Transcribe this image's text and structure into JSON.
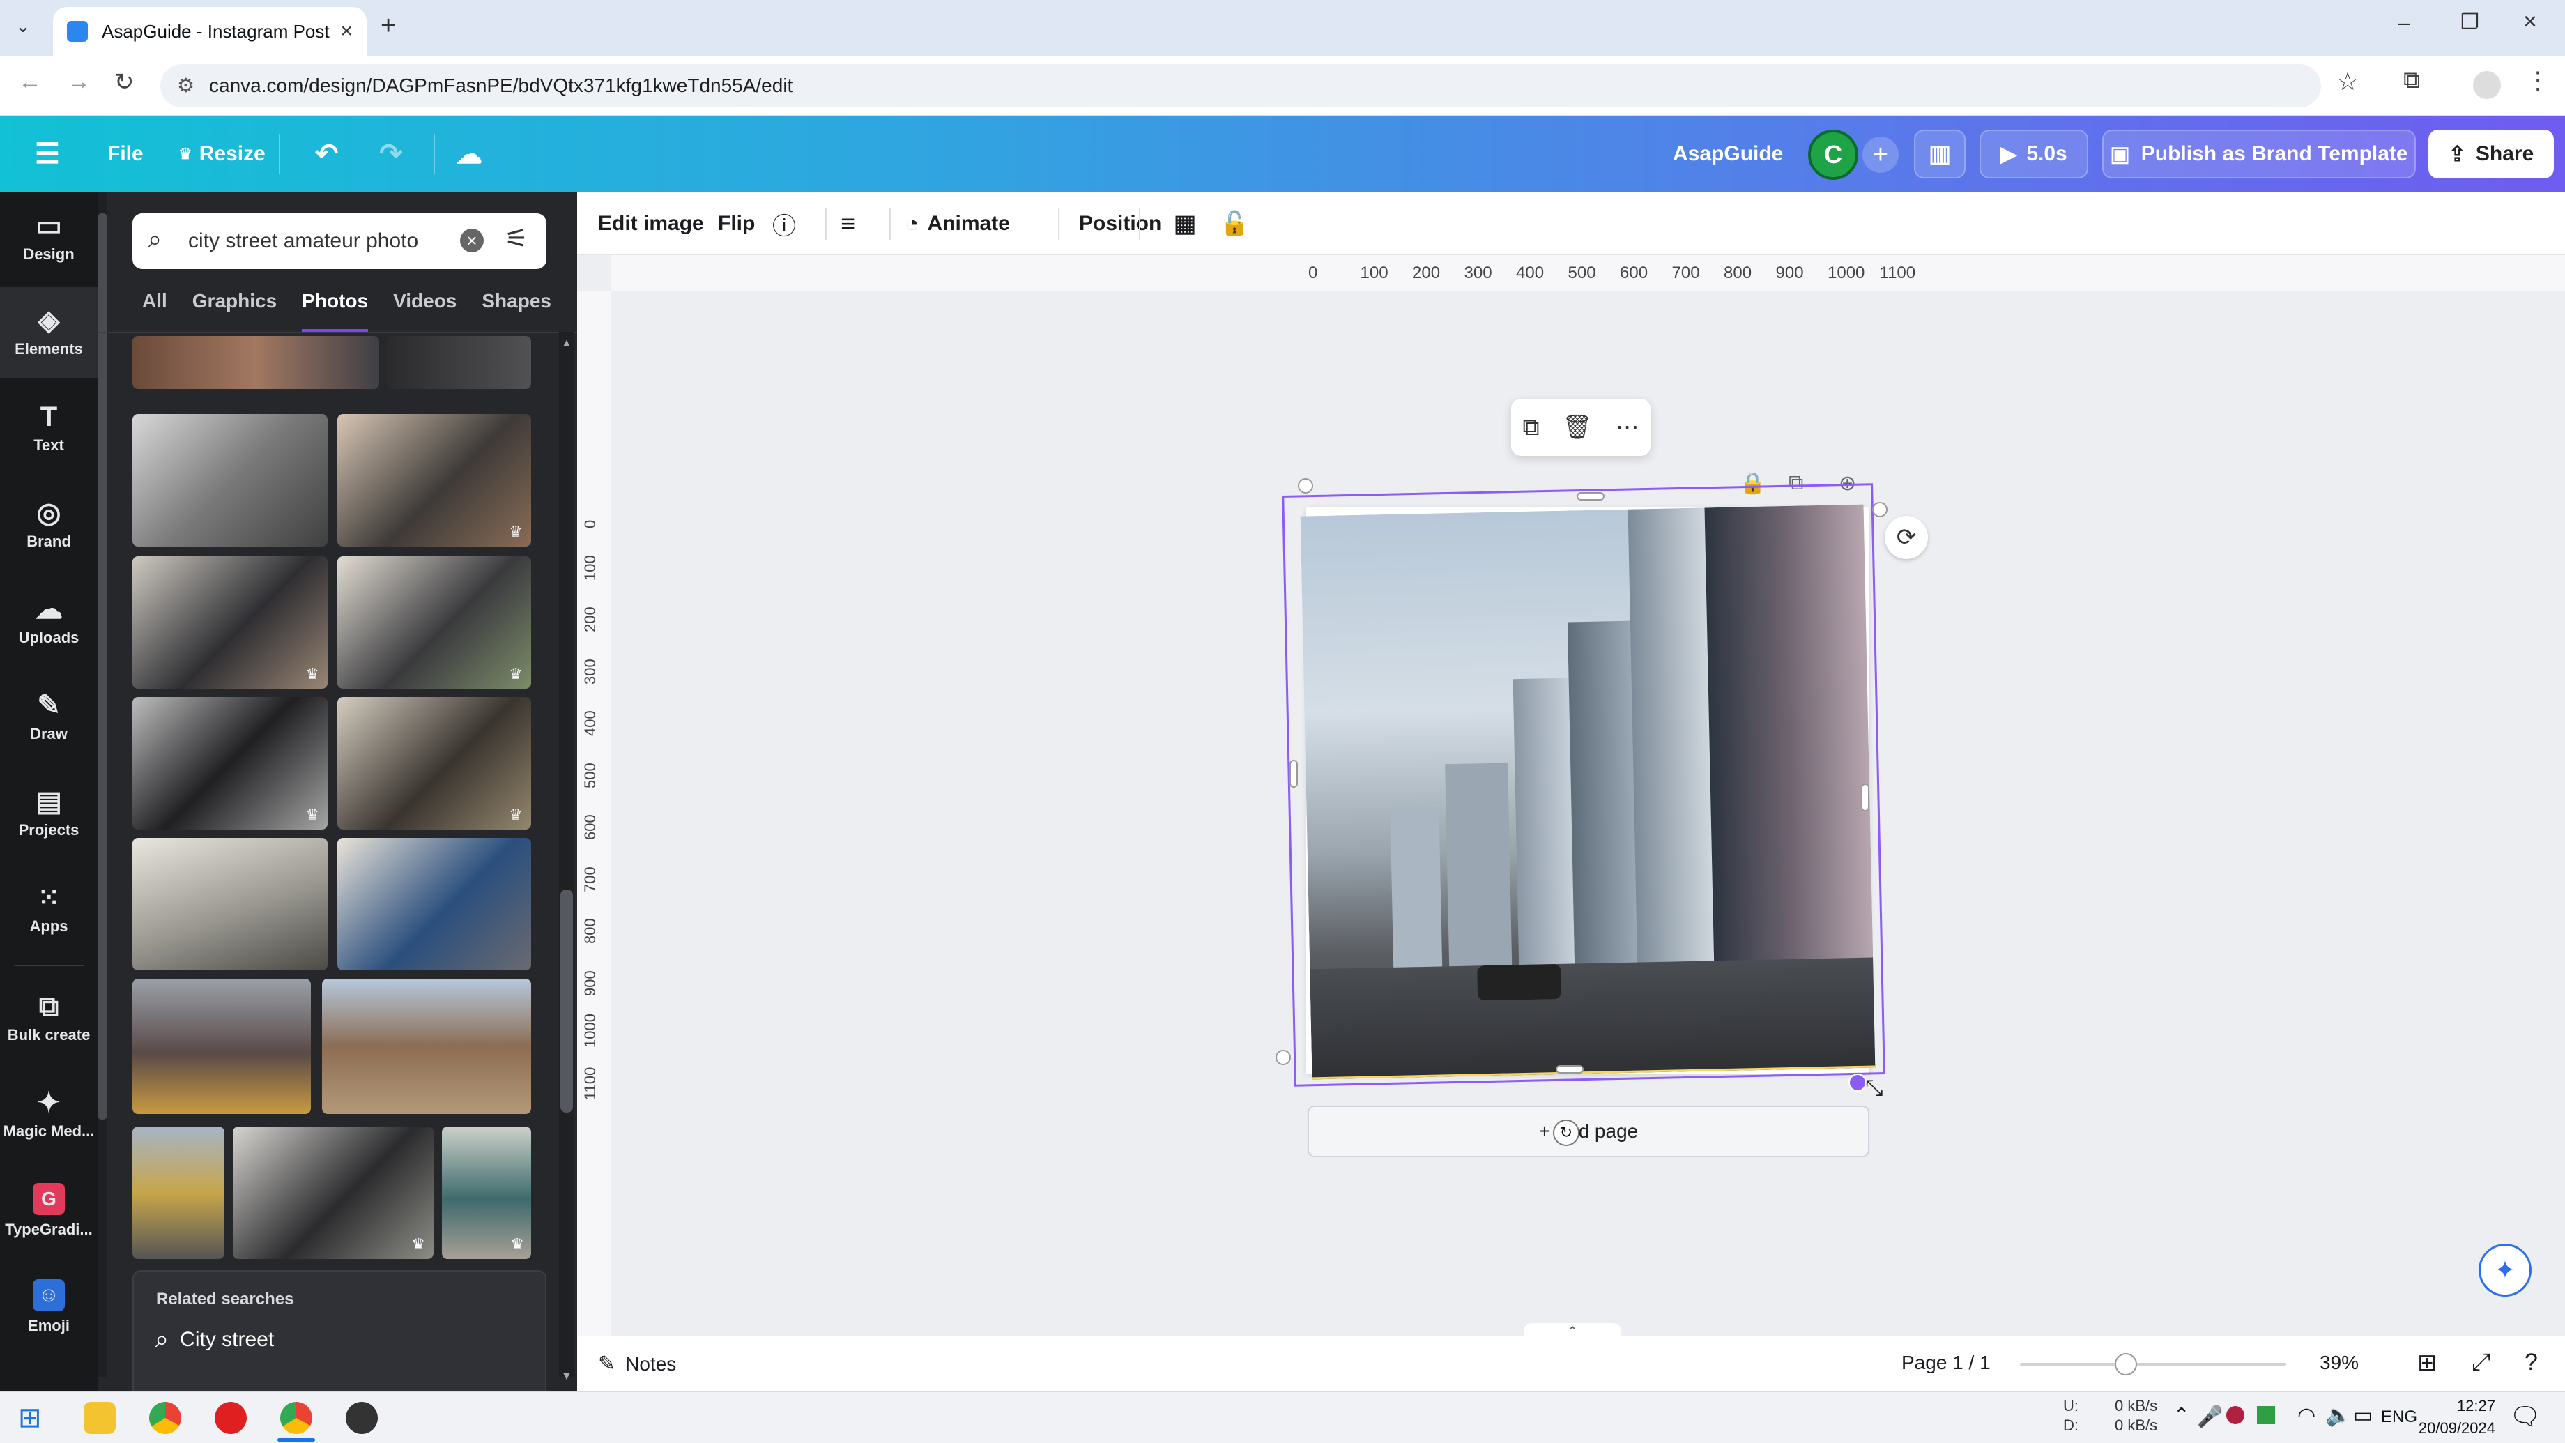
{
  "browser": {
    "tab_title": "AsapGuide - Instagram Post",
    "url": "canva.com/design/DAGPmFasnPE/bdVQtx371kfg1kweTdn55A/edit"
  },
  "header": {
    "file": "File",
    "resize": "Resize",
    "team_name": "AsapGuide",
    "avatar_letter": "C",
    "play_duration": "5.0s",
    "publish_label": "Publish as Brand Template",
    "share_label": "Share"
  },
  "rail": [
    {
      "label": "Design",
      "icon": "▭"
    },
    {
      "label": "Elements",
      "icon": "◈"
    },
    {
      "label": "Text",
      "icon": "T"
    },
    {
      "label": "Brand",
      "icon": "◎"
    },
    {
      "label": "Uploads",
      "icon": "☁"
    },
    {
      "label": "Draw",
      "icon": "✎"
    },
    {
      "label": "Projects",
      "icon": "▤"
    },
    {
      "label": "Apps",
      "icon": "⁙"
    },
    {
      "label": "Bulk create",
      "icon": "⧉"
    },
    {
      "label": "Magic Med...",
      "icon": "✦"
    },
    {
      "label": "TypeGradi...",
      "icon": "G"
    },
    {
      "label": "Emoji",
      "icon": "☺"
    }
  ],
  "panel": {
    "search_value": "city street amateur photo",
    "tabs": [
      "All",
      "Graphics",
      "Photos",
      "Videos",
      "Shapes"
    ],
    "active_tab": "Photos",
    "related_title": "Related searches",
    "related_items": [
      "City street"
    ]
  },
  "toolbar": {
    "edit_image": "Edit image",
    "flip": "Flip",
    "animate": "Animate",
    "position": "Position"
  },
  "ruler": {
    "top": [
      "0",
      "100",
      "200",
      "300",
      "400",
      "500",
      "600",
      "700",
      "800",
      "900",
      "1000",
      "1100"
    ],
    "left": [
      "0",
      "100",
      "200",
      "300",
      "400",
      "500",
      "600",
      "700",
      "800",
      "900",
      "1000",
      "1100"
    ]
  },
  "canvas": {
    "add_page": "+ Add page"
  },
  "bottom": {
    "notes": "Notes",
    "page": "Page 1 / 1",
    "zoom": "39%"
  },
  "taskbar": {
    "net_up": "0 kB/s",
    "net_down": "0 kB/s",
    "net_up_label": "U:",
    "net_down_label": "D:",
    "lang": "ENG",
    "time": "12:27",
    "date": "20/09/2024"
  },
  "colors": {
    "accent": "#8b3dff",
    "selection": "#8b5cf6",
    "header_start": "#12c1d5",
    "header_end": "#6f5cf0"
  }
}
